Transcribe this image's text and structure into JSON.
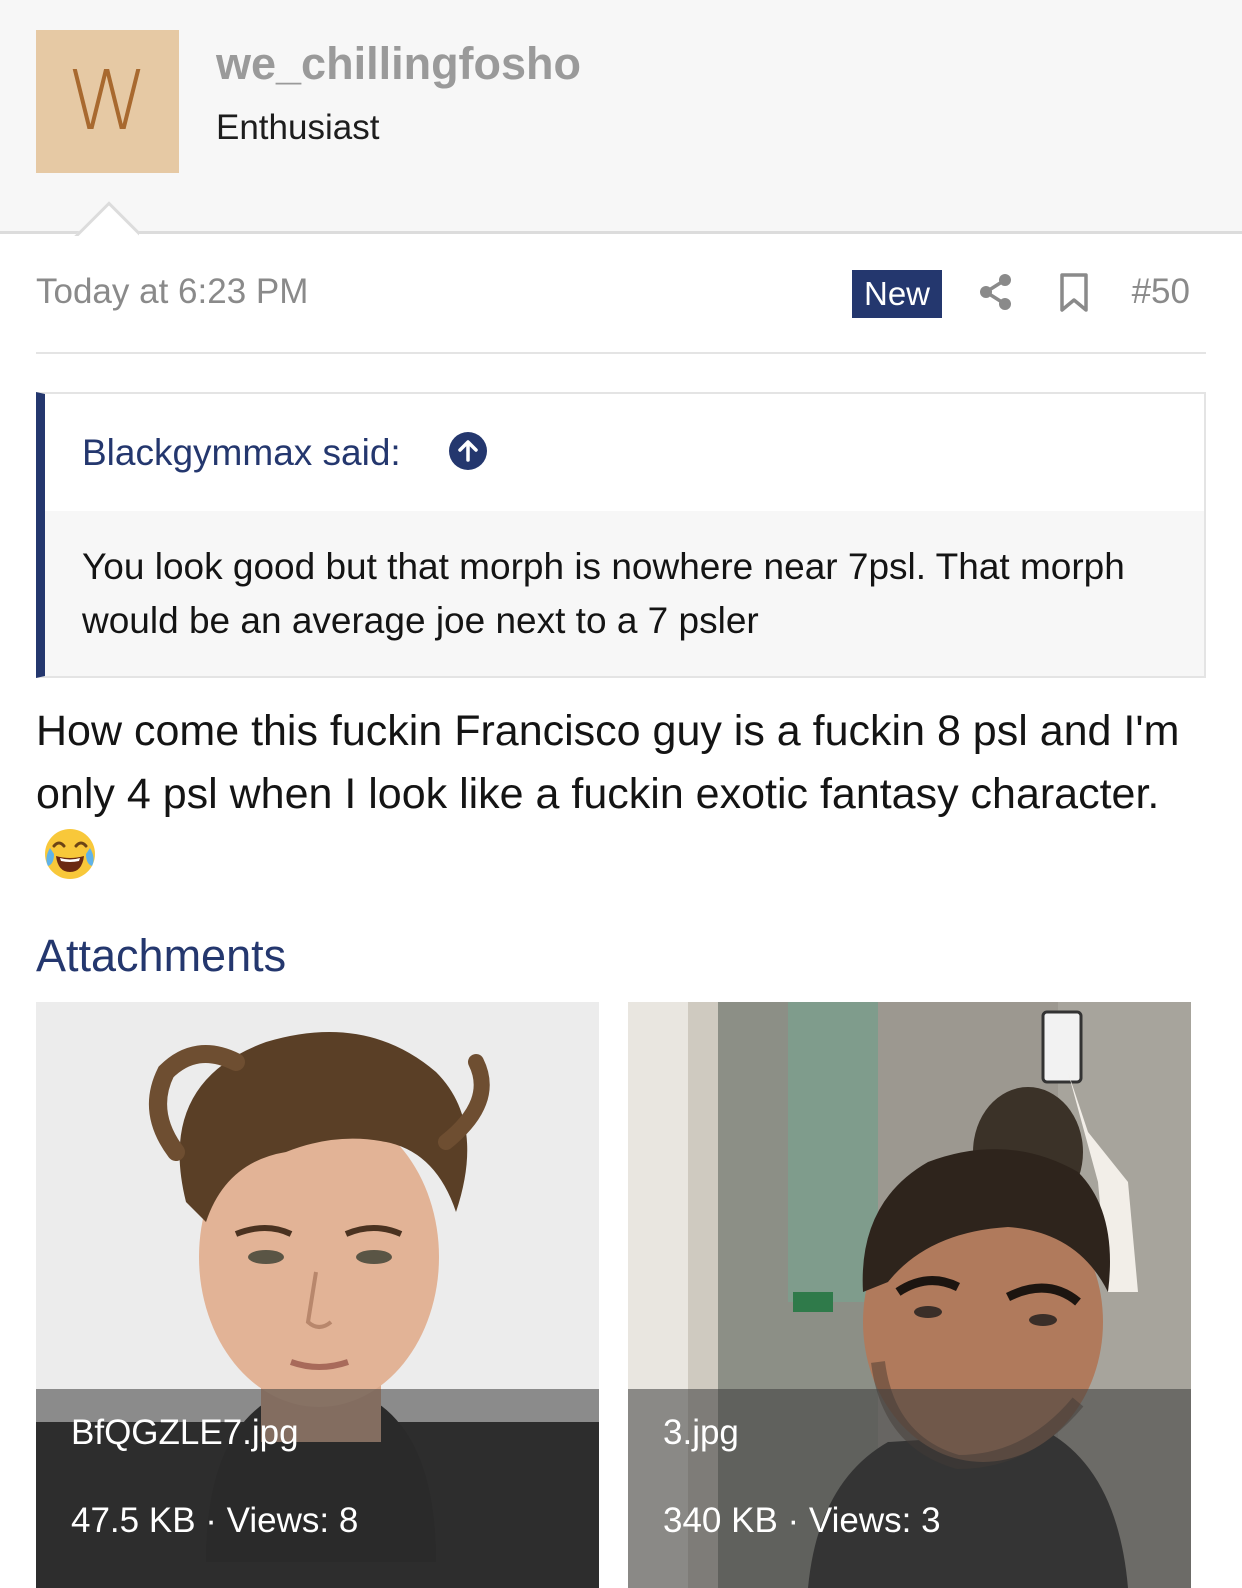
{
  "user": {
    "avatar_letter": "W",
    "username": "we_chillingfosho",
    "title": "Enthusiast",
    "avatar_bg": "#e6c9a4",
    "avatar_fg": "#a8692f"
  },
  "post": {
    "date": "Today at 6:23 PM",
    "badge": "New",
    "number": "#50",
    "share_icon": "share-icon",
    "bookmark_icon": "bookmark-icon",
    "body": "How come this fuckin Francisco guy is a fuckin 8 psl and I'm only 4 psl when I look like a fuckin exotic fantasy character.",
    "emoji": "face-with-tears-of-joy"
  },
  "quote": {
    "author_label": "Blackgymmax said:",
    "jump_icon": "arrow-up-circle-icon",
    "text": "You look good but that morph is nowhere near 7psl. That morph would be an average joe next to a 7 psler"
  },
  "attachments": {
    "heading": "Attachments",
    "items": [
      {
        "filename": "BfQGZLE7.jpg",
        "meta": "47.5 KB · Views: 8"
      },
      {
        "filename": "3.jpg",
        "meta": "340 KB · Views: 3"
      }
    ]
  },
  "colors": {
    "accent": "#24376e",
    "muted_text": "#8a8a8a",
    "header_bg": "#f7f7f7"
  }
}
